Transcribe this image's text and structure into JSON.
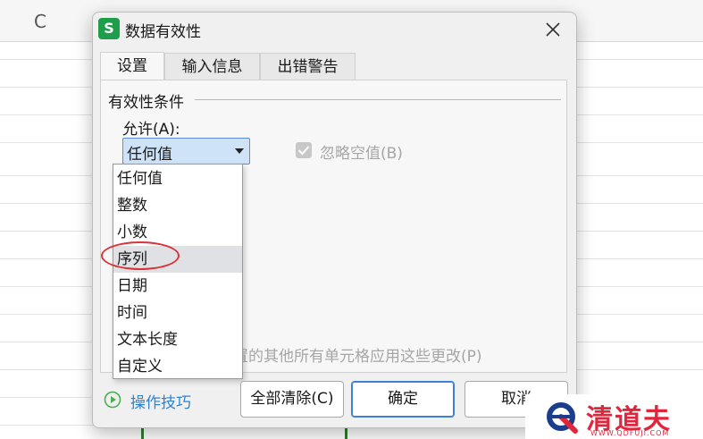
{
  "sheet": {
    "column_label": "C"
  },
  "dialog": {
    "title": "数据有效性",
    "tabs": [
      {
        "label": "设置"
      },
      {
        "label": "输入信息"
      },
      {
        "label": "出错警告"
      }
    ],
    "group_title": "有效性条件",
    "allow_label": "允许(A):",
    "allow_selected": "任何值",
    "ignore_blank_label": "忽略空值(B)",
    "apply_all_partial": "置的其他所有单元格应用这些更改(P)",
    "dropdown_options": [
      {
        "label": "任何值"
      },
      {
        "label": "整数"
      },
      {
        "label": "小数"
      },
      {
        "label": "序列"
      },
      {
        "label": "日期"
      },
      {
        "label": "时间"
      },
      {
        "label": "文本长度"
      },
      {
        "label": "自定义"
      }
    ],
    "tips_label": "操作技巧",
    "buttons": {
      "clear_all": "全部清除(C)",
      "ok": "确定",
      "cancel": "取消"
    }
  },
  "watermark": {
    "brand": "清道夫",
    "url": "WWW.QDFUJI.COM"
  },
  "colors": {
    "accent": "#3f7fd4",
    "highlight_oval": "#d9343a",
    "tips_link": "#2e82d0",
    "app_icon": "#1e9e4a",
    "watermark": "#e0263c"
  }
}
